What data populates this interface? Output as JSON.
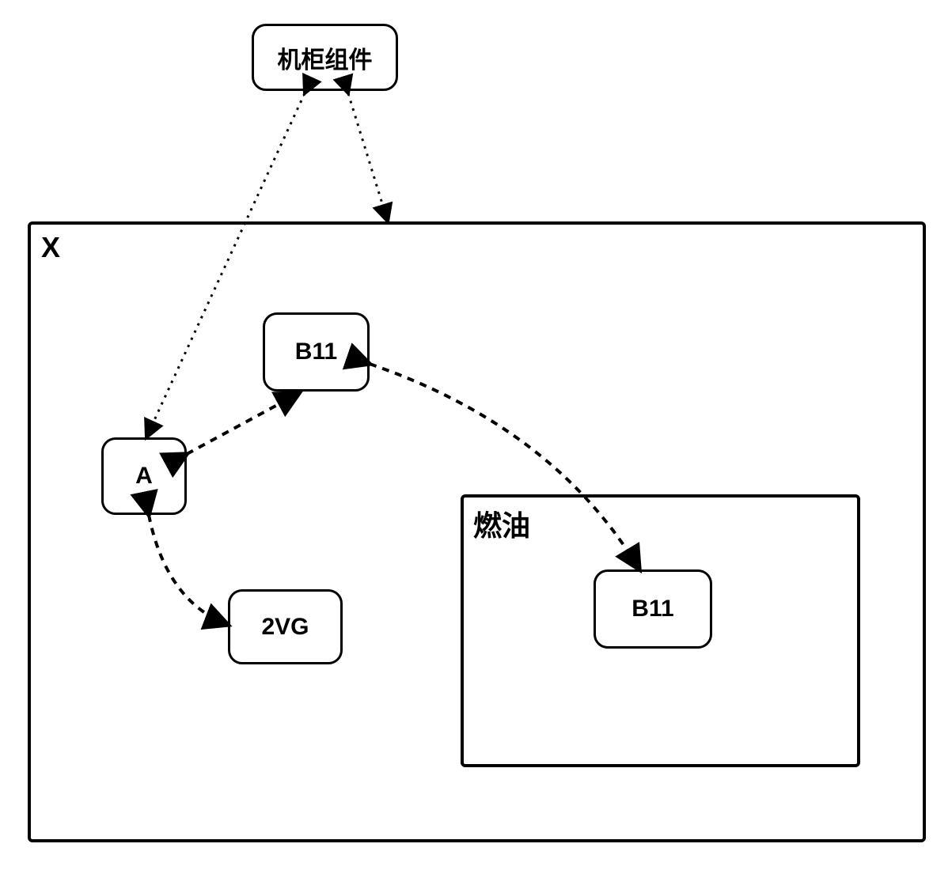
{
  "nodes": {
    "cabinet": {
      "label": "机柜组件"
    },
    "x_container": {
      "label": "X"
    },
    "a": {
      "label": "A"
    },
    "b11_top": {
      "label": "B11"
    },
    "twoVG": {
      "label": "2VG"
    },
    "fuel_container": {
      "label": "燃油"
    },
    "b11_inner": {
      "label": "B11"
    }
  },
  "edges": [
    {
      "from": "cabinet",
      "to": "x_container",
      "bidirectional": true,
      "style": "dotted"
    },
    {
      "from": "cabinet",
      "to": "a",
      "bidirectional": true,
      "style": "dotted"
    },
    {
      "from": "a",
      "to": "b11_top",
      "bidirectional": true,
      "style": "dashed"
    },
    {
      "from": "a",
      "to": "twoVG",
      "bidirectional": true,
      "style": "dashed"
    },
    {
      "from": "b11_top",
      "to": "b11_inner",
      "bidirectional": true,
      "style": "dashed"
    }
  ],
  "diagram_type": "component-relationship"
}
